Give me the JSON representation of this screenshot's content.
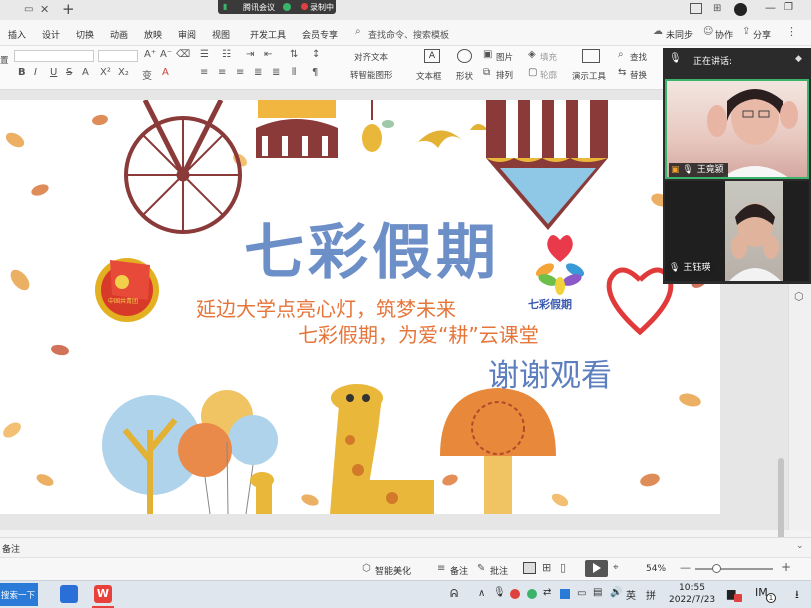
{
  "titlebar": {
    "meeting_app": "腾讯会议",
    "recording": "录制中",
    "new_tab": "+"
  },
  "menu": {
    "items": [
      "插入",
      "设计",
      "切换",
      "动画",
      "放映",
      "审阅",
      "视图",
      "开发工具",
      "会员专享"
    ],
    "search_placeholder": "查找命令、搜索模板",
    "sync_status": "未同步",
    "collaborate": "协作",
    "share": "分享"
  },
  "ribbon": {
    "left_label": "置",
    "align_text": "对齐文本",
    "smartart": "转智能图形",
    "textbox": "文本框",
    "shapes": "形状",
    "picture": "图片",
    "fill": "填充",
    "arrange": "排列",
    "outline": "轮廓",
    "presenter_tools": "演示工具",
    "find": "查找",
    "replace": "替换"
  },
  "video_panel": {
    "speaking_label": "正在讲话:",
    "participants": [
      {
        "name": "王竟颍"
      },
      {
        "name": "王钰瑛"
      }
    ]
  },
  "slide": {
    "title": "七彩假期",
    "line1": "延边大学点亮心灯，筑梦未来",
    "line2": "七彩假期，为爱“耕”云课堂",
    "thanks": "谢谢观看",
    "logo_text": "七彩假期",
    "emblem_text": "中国共青团"
  },
  "notes": {
    "label": "备注"
  },
  "statusbar": {
    "beautify": "智能美化",
    "notes": "备注",
    "comments": "批注",
    "zoom": "54%"
  },
  "taskbar": {
    "search": "搜索一下",
    "ime": "英",
    "time": "10:55",
    "date": "2022/7/23",
    "notif_count": "1"
  },
  "colors": {
    "title_blue": "#6d8fc7",
    "subtitle_orange": "#e6753a",
    "thanks_blue": "#5d7fbf",
    "wps_red": "#e8403a",
    "speaking_green": "#3bb36b"
  }
}
